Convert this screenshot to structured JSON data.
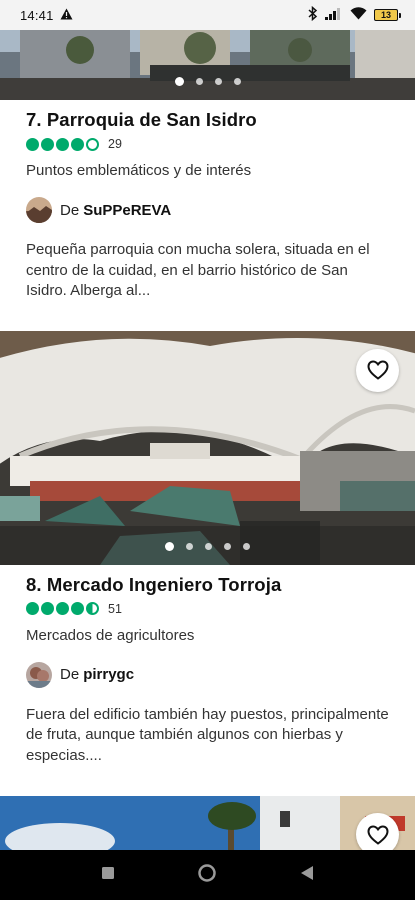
{
  "status_bar": {
    "time": "14:41",
    "battery": "13"
  },
  "places": [
    {
      "title": "7. Parroquia de San Isidro",
      "rating": 4,
      "review_count": "29",
      "category": "Puntos emblemáticos y de interés",
      "author_prefix": "De",
      "author": "SuPPeREVA",
      "review": "Pequeña parroquia con mucha solera, situada en el centro de la cuidad, en el barrio histórico de San Isidro. Alberga al...",
      "photo_count": 4,
      "active_photo": 1
    },
    {
      "title": "8. Mercado Ingeniero Torroja",
      "rating": 4.5,
      "review_count": "51",
      "category": "Mercados de agricultores",
      "author_prefix": "De",
      "author": "pirrygc",
      "review": "Fuera del edificio también hay puestos, principalmente de fruta, aunque también algunos con hierbas y especias....",
      "photo_count": 5,
      "active_photo": 1
    }
  ],
  "icons": {
    "favorite": "heart-outline-icon",
    "rating_bubble": "circle-icon",
    "nav_recents": "square-icon",
    "nav_home": "circle-icon",
    "nav_back": "triangle-icon"
  },
  "colors": {
    "rating_green": "#00aa6c",
    "nav_bar": "#000000",
    "status_bar": "#f3f3f3"
  }
}
